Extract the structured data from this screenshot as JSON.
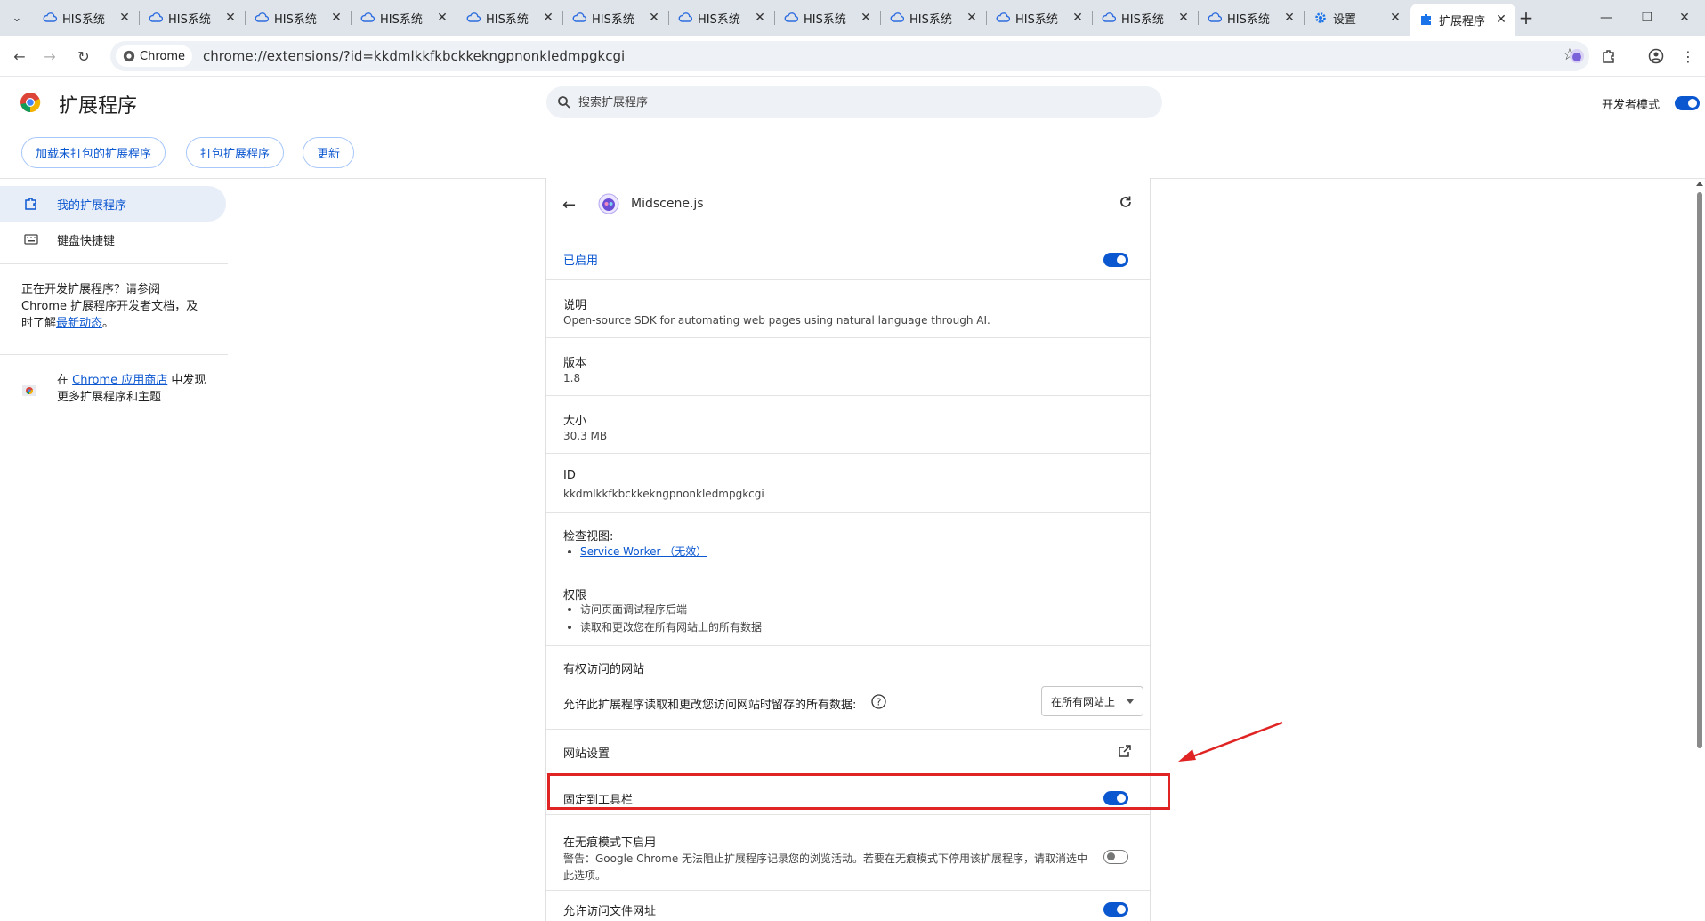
{
  "tabs": [
    {
      "label": "HIS系统"
    },
    {
      "label": "HIS系统"
    },
    {
      "label": "HIS系统"
    },
    {
      "label": "HIS系统"
    },
    {
      "label": "HIS系统"
    },
    {
      "label": "HIS系统"
    },
    {
      "label": "HIS系统"
    },
    {
      "label": "HIS系统"
    },
    {
      "label": "HIS系统"
    },
    {
      "label": "HIS系统"
    },
    {
      "label": "HIS系统"
    },
    {
      "label": "HIS系统"
    },
    {
      "label": "设置"
    },
    {
      "label": "扩展程序"
    }
  ],
  "toolbar": {
    "chip_label": "Chrome",
    "url": "chrome://extensions/?id=kkdmlkkfkbckkekngpnonkledmpgkcgi"
  },
  "header": {
    "title": "扩展程序",
    "search_placeholder": "搜索扩展程序",
    "dev_mode_label": "开发者模式",
    "dev_mode_on": true
  },
  "actions": {
    "load_unpacked": "加载未打包的扩展程序",
    "pack": "打包扩展程序",
    "update": "更新"
  },
  "sidebar": {
    "items": [
      {
        "label": "我的扩展程序"
      },
      {
        "label": "键盘快捷键"
      }
    ],
    "note_prefix": "正在开发扩展程序？请参阅 Chrome 扩展程序开发者文档，及时了解",
    "note_link": "最新动态",
    "note_suffix": "。",
    "store_prefix": "在 ",
    "store_link": "Chrome 应用商店",
    "store_suffix": " 中发现更多扩展程序和主题"
  },
  "detail": {
    "name": "Midscene.js",
    "enabled_label": "已启用",
    "description_label": "说明",
    "description": "Open-source SDK for automating web pages using natural language through AI.",
    "version_label": "版本",
    "version": "1.8",
    "size_label": "大小",
    "size": "30.3 MB",
    "id_label": "ID",
    "id": "kkdmlkkfkbckkekngpnonkledmpgkcgi",
    "inspect_label": "检查视图:",
    "inspect_link": "Service Worker （无效）",
    "permissions_label": "权限",
    "permissions": [
      "访问页面调试程序后端",
      "读取和更改您在所有网站上的所有数据"
    ],
    "site_access_label": "有权访问的网站",
    "site_access_desc": "允许此扩展程序读取和更改您访问网站时留存的所有数据:",
    "site_access_value": "在所有网站上",
    "site_settings_label": "网站设置",
    "pin_label": "固定到工具栏",
    "pin_on": true,
    "incognito_label": "在无痕模式下启用",
    "incognito_warning": "警告：Google Chrome 无法阻止扩展程序记录您的浏览活动。若要在无痕模式下停用该扩展程序，请取消选中此选项。",
    "incognito_on": false,
    "file_url_label": "允许访问文件网址",
    "file_url_on": true
  },
  "colors": {
    "accent": "#0b57d0",
    "annotation": "#e02424"
  }
}
